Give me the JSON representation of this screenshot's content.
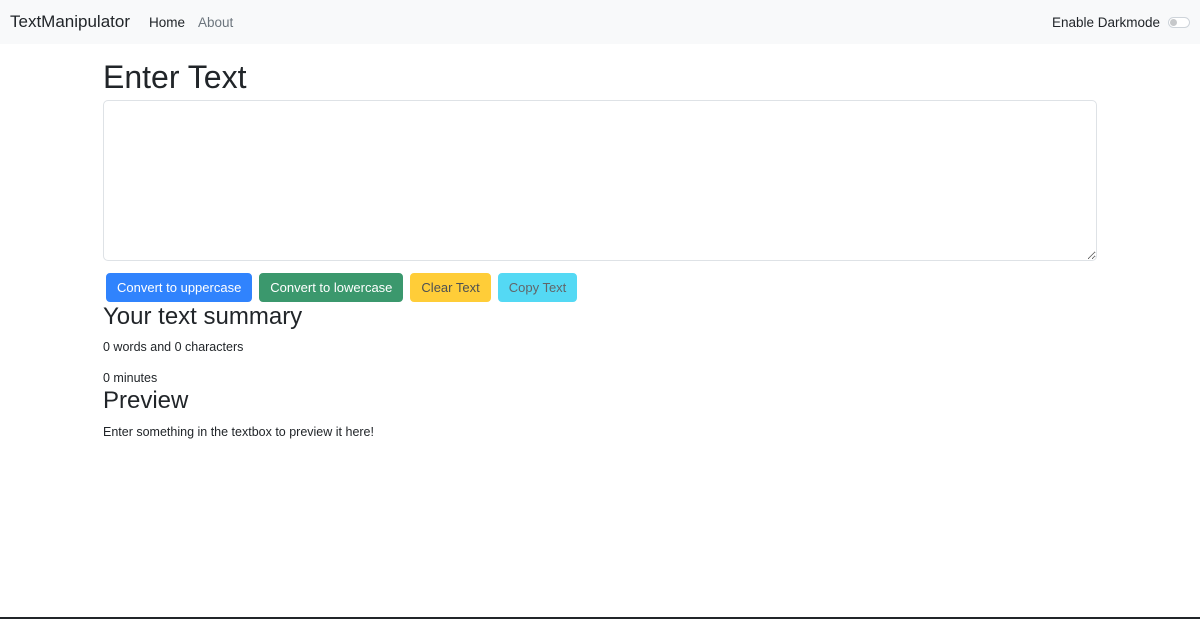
{
  "navbar": {
    "brand": "TextManipulator",
    "links": [
      {
        "label": "Home",
        "active": true
      },
      {
        "label": "About",
        "active": false
      }
    ],
    "darkmode_label": "Enable Darkmode",
    "darkmode_enabled": false
  },
  "main": {
    "heading": "Enter Text",
    "textarea_value": "",
    "buttons": {
      "uppercase": "Convert to uppercase",
      "lowercase": "Convert to lowercase",
      "clear": "Clear Text",
      "copy": "Copy Text"
    }
  },
  "summary": {
    "heading": "Your text summary",
    "counts": "0 words and 0 characters",
    "read_time": "0 minutes"
  },
  "preview": {
    "heading": "Preview",
    "text": "Enter something in the textbox to preview it here!"
  },
  "colors": {
    "navbar_bg": "#f8f9fa",
    "primary": "#0d6efd",
    "success": "#198754",
    "warning": "#ffc107",
    "info": "#0dcaf0"
  }
}
